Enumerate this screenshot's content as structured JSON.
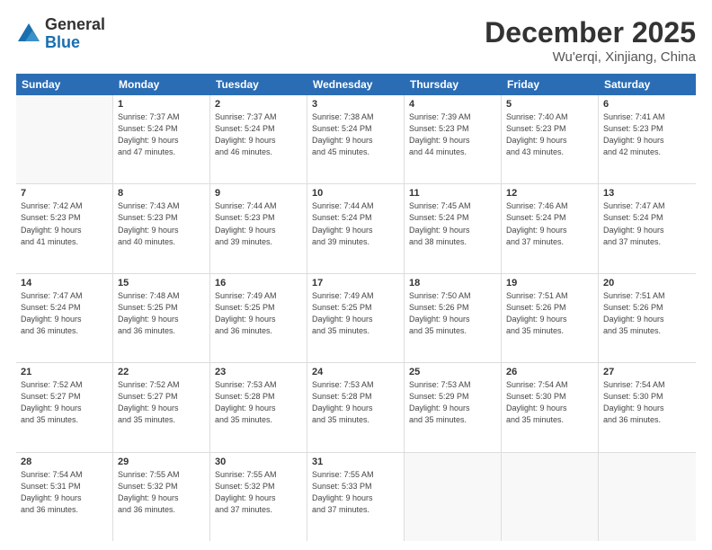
{
  "header": {
    "logo_general": "General",
    "logo_blue": "Blue",
    "main_title": "December 2025",
    "subtitle": "Wu'erqi, Xinjiang, China"
  },
  "weekdays": [
    "Sunday",
    "Monday",
    "Tuesday",
    "Wednesday",
    "Thursday",
    "Friday",
    "Saturday"
  ],
  "rows": [
    [
      {
        "day": "",
        "info": "",
        "empty": true
      },
      {
        "day": "1",
        "info": "Sunrise: 7:37 AM\nSunset: 5:24 PM\nDaylight: 9 hours\nand 47 minutes."
      },
      {
        "day": "2",
        "info": "Sunrise: 7:37 AM\nSunset: 5:24 PM\nDaylight: 9 hours\nand 46 minutes."
      },
      {
        "day": "3",
        "info": "Sunrise: 7:38 AM\nSunset: 5:24 PM\nDaylight: 9 hours\nand 45 minutes."
      },
      {
        "day": "4",
        "info": "Sunrise: 7:39 AM\nSunset: 5:23 PM\nDaylight: 9 hours\nand 44 minutes."
      },
      {
        "day": "5",
        "info": "Sunrise: 7:40 AM\nSunset: 5:23 PM\nDaylight: 9 hours\nand 43 minutes."
      },
      {
        "day": "6",
        "info": "Sunrise: 7:41 AM\nSunset: 5:23 PM\nDaylight: 9 hours\nand 42 minutes."
      }
    ],
    [
      {
        "day": "7",
        "info": "Sunrise: 7:42 AM\nSunset: 5:23 PM\nDaylight: 9 hours\nand 41 minutes."
      },
      {
        "day": "8",
        "info": "Sunrise: 7:43 AM\nSunset: 5:23 PM\nDaylight: 9 hours\nand 40 minutes."
      },
      {
        "day": "9",
        "info": "Sunrise: 7:44 AM\nSunset: 5:23 PM\nDaylight: 9 hours\nand 39 minutes."
      },
      {
        "day": "10",
        "info": "Sunrise: 7:44 AM\nSunset: 5:24 PM\nDaylight: 9 hours\nand 39 minutes."
      },
      {
        "day": "11",
        "info": "Sunrise: 7:45 AM\nSunset: 5:24 PM\nDaylight: 9 hours\nand 38 minutes."
      },
      {
        "day": "12",
        "info": "Sunrise: 7:46 AM\nSunset: 5:24 PM\nDaylight: 9 hours\nand 37 minutes."
      },
      {
        "day": "13",
        "info": "Sunrise: 7:47 AM\nSunset: 5:24 PM\nDaylight: 9 hours\nand 37 minutes."
      }
    ],
    [
      {
        "day": "14",
        "info": "Sunrise: 7:47 AM\nSunset: 5:24 PM\nDaylight: 9 hours\nand 36 minutes."
      },
      {
        "day": "15",
        "info": "Sunrise: 7:48 AM\nSunset: 5:25 PM\nDaylight: 9 hours\nand 36 minutes."
      },
      {
        "day": "16",
        "info": "Sunrise: 7:49 AM\nSunset: 5:25 PM\nDaylight: 9 hours\nand 36 minutes."
      },
      {
        "day": "17",
        "info": "Sunrise: 7:49 AM\nSunset: 5:25 PM\nDaylight: 9 hours\nand 35 minutes."
      },
      {
        "day": "18",
        "info": "Sunrise: 7:50 AM\nSunset: 5:26 PM\nDaylight: 9 hours\nand 35 minutes."
      },
      {
        "day": "19",
        "info": "Sunrise: 7:51 AM\nSunset: 5:26 PM\nDaylight: 9 hours\nand 35 minutes."
      },
      {
        "day": "20",
        "info": "Sunrise: 7:51 AM\nSunset: 5:26 PM\nDaylight: 9 hours\nand 35 minutes."
      }
    ],
    [
      {
        "day": "21",
        "info": "Sunrise: 7:52 AM\nSunset: 5:27 PM\nDaylight: 9 hours\nand 35 minutes."
      },
      {
        "day": "22",
        "info": "Sunrise: 7:52 AM\nSunset: 5:27 PM\nDaylight: 9 hours\nand 35 minutes."
      },
      {
        "day": "23",
        "info": "Sunrise: 7:53 AM\nSunset: 5:28 PM\nDaylight: 9 hours\nand 35 minutes."
      },
      {
        "day": "24",
        "info": "Sunrise: 7:53 AM\nSunset: 5:28 PM\nDaylight: 9 hours\nand 35 minutes."
      },
      {
        "day": "25",
        "info": "Sunrise: 7:53 AM\nSunset: 5:29 PM\nDaylight: 9 hours\nand 35 minutes."
      },
      {
        "day": "26",
        "info": "Sunrise: 7:54 AM\nSunset: 5:30 PM\nDaylight: 9 hours\nand 35 minutes."
      },
      {
        "day": "27",
        "info": "Sunrise: 7:54 AM\nSunset: 5:30 PM\nDaylight: 9 hours\nand 36 minutes."
      }
    ],
    [
      {
        "day": "28",
        "info": "Sunrise: 7:54 AM\nSunset: 5:31 PM\nDaylight: 9 hours\nand 36 minutes."
      },
      {
        "day": "29",
        "info": "Sunrise: 7:55 AM\nSunset: 5:32 PM\nDaylight: 9 hours\nand 36 minutes."
      },
      {
        "day": "30",
        "info": "Sunrise: 7:55 AM\nSunset: 5:32 PM\nDaylight: 9 hours\nand 37 minutes."
      },
      {
        "day": "31",
        "info": "Sunrise: 7:55 AM\nSunset: 5:33 PM\nDaylight: 9 hours\nand 37 minutes."
      },
      {
        "day": "",
        "info": "",
        "empty": true
      },
      {
        "day": "",
        "info": "",
        "empty": true
      },
      {
        "day": "",
        "info": "",
        "empty": true
      }
    ]
  ]
}
